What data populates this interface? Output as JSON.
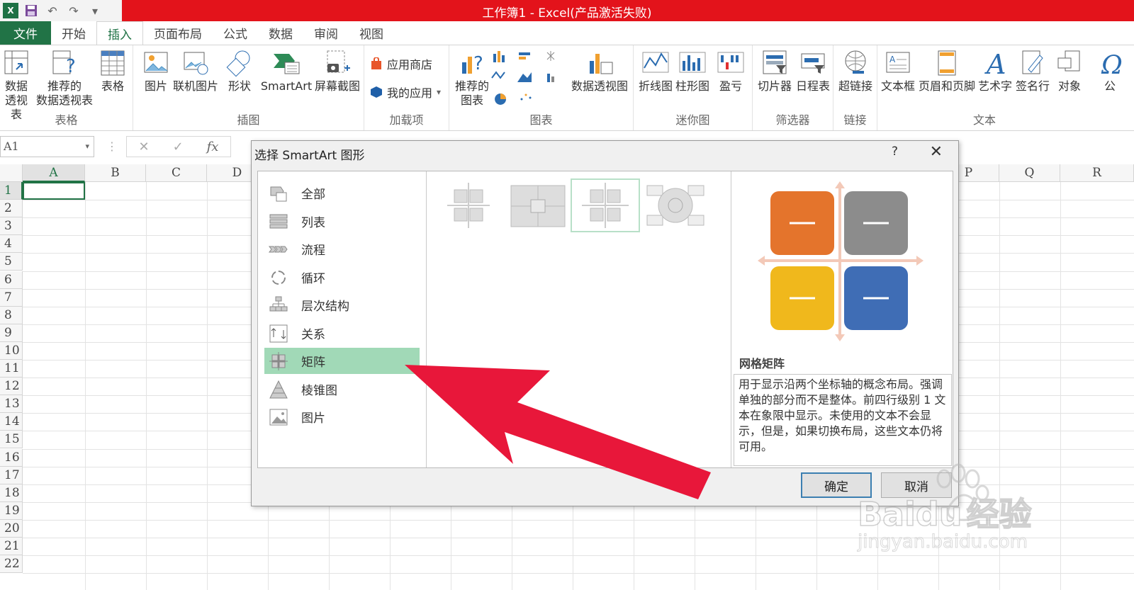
{
  "window": {
    "title": "工作簿1 -  Excel(产品激活失败)"
  },
  "tabs": [
    {
      "label": "文件"
    },
    {
      "label": "开始"
    },
    {
      "label": "插入"
    },
    {
      "label": "页面布局"
    },
    {
      "label": "公式"
    },
    {
      "label": "数据"
    },
    {
      "label": "审阅"
    },
    {
      "label": "视图"
    }
  ],
  "ribbon": {
    "tables": {
      "label": "表格",
      "pivot_l1": "数据",
      "pivot_l2": "透视表",
      "rec_pivot_l1": "推荐的",
      "rec_pivot_l2": "数据透视表",
      "table": "表格"
    },
    "illustrations": {
      "label": "插图",
      "picture": "图片",
      "online_picture": "联机图片",
      "shapes": "形状",
      "smartart": "SmartArt",
      "screenshot": "屏幕截图"
    },
    "addins": {
      "label": "加载项",
      "store": "应用商店",
      "my_apps": "我的应用"
    },
    "charts": {
      "label": "图表",
      "rec_l1": "推荐的",
      "rec_l2": "图表",
      "pivot_chart": "数据透视图"
    },
    "sparklines": {
      "label": "迷你图",
      "line": "折线图",
      "column": "柱形图",
      "winloss": "盈亏"
    },
    "filters": {
      "label": "筛选器",
      "slicer": "切片器",
      "timeline": "日程表"
    },
    "links": {
      "label": "链接",
      "hyperlink": "超链接"
    },
    "text": {
      "label": "文本",
      "textbox": "文本框",
      "header_footer": "页眉和页脚",
      "wordart": "艺术字",
      "signature": "签名行",
      "object": "对象"
    },
    "symbols_partial": "公"
  },
  "formula_bar": {
    "name_box": "A1",
    "fx": "fx"
  },
  "grid": {
    "columns": [
      "A",
      "B",
      "C",
      "D",
      "P",
      "Q",
      "R"
    ],
    "rows": [
      "1",
      "2",
      "3",
      "4",
      "5",
      "6",
      "7",
      "8",
      "9",
      "10",
      "11",
      "12",
      "13",
      "14",
      "15",
      "16",
      "17",
      "18",
      "19",
      "20",
      "21",
      "22"
    ],
    "selected_cell": "A1"
  },
  "dialog": {
    "title": "选择 SmartArt 图形",
    "help": "?",
    "categories": [
      {
        "label": "全部"
      },
      {
        "label": "列表"
      },
      {
        "label": "流程"
      },
      {
        "label": "循环"
      },
      {
        "label": "层次结构"
      },
      {
        "label": "关系"
      },
      {
        "label": "矩阵"
      },
      {
        "label": "棱锥图"
      },
      {
        "label": "图片"
      }
    ],
    "selected_category": "矩阵",
    "preview": {
      "name": "网格矩阵",
      "description": "用于显示沿两个坐标轴的概念布局。强调单独的部分而不是整体。前四行级别 1 文本在象限中显示。未使用的文本不会显示，但是，如果切换布局，这些文本仍将可用。",
      "quadrant_colors": [
        "#e4742c",
        "#8c8c8c",
        "#f0b81c",
        "#3f6db5"
      ]
    },
    "ok": "确定",
    "cancel": "取消"
  },
  "watermark": {
    "brand": "Bai",
    "brand2": "du",
    "cn": "经验",
    "url": "jingyan.baidu.com"
  },
  "colors": {
    "accent": "#217346",
    "titlebar": "#e3131b",
    "arrow": "#e8173a",
    "selected": "#a1d9b7"
  }
}
